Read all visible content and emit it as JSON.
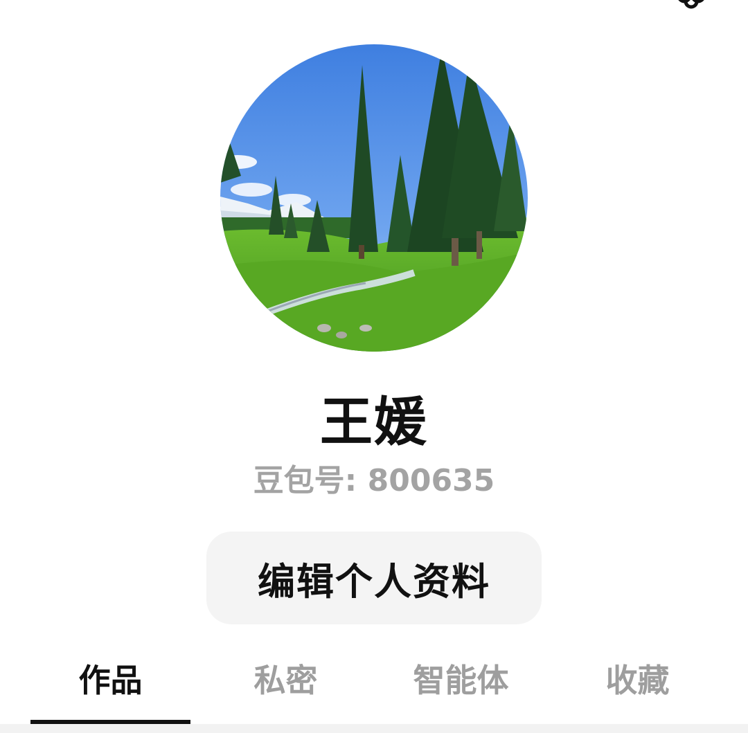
{
  "top_bar": {
    "settings_icon": "flower-gear-icon"
  },
  "profile": {
    "avatar_icon": "landscape-photo-avatar",
    "name": "王媛",
    "id_text": "豆包号: 800635",
    "edit_button_label": "编辑个人资料"
  },
  "tabs": [
    {
      "label": "作品",
      "active": true
    },
    {
      "label": "私密",
      "active": false
    },
    {
      "label": "智能体",
      "active": false
    },
    {
      "label": "收藏",
      "active": false
    }
  ],
  "colors": {
    "active_text": "#111111",
    "inactive_text": "#9e9e9e",
    "id_text": "#a3a3a3",
    "button_bg": "#f4f4f4"
  }
}
